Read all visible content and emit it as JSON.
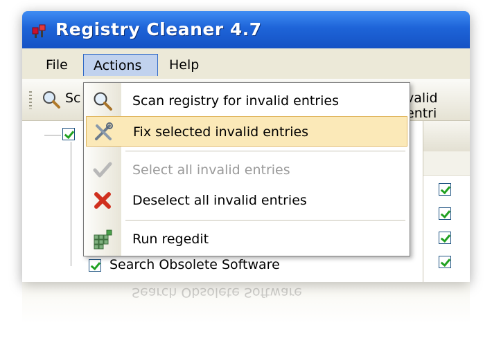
{
  "window": {
    "title": "Registry Cleaner 4.7"
  },
  "menubar": {
    "items": [
      "File",
      "Actions",
      "Help"
    ]
  },
  "toolbar": {
    "left_text": "Sc",
    "right_text": "valid entri"
  },
  "tree": {
    "visible_item": "Search Obsolete Software"
  },
  "actions_menu": {
    "items": [
      {
        "label": "Scan registry for invalid entries",
        "icon": "magnifier-icon",
        "state": "normal"
      },
      {
        "label": "Fix selected invalid entries",
        "icon": "repair-tools-icon",
        "state": "highlighted"
      },
      {
        "label": "Select all invalid entries",
        "icon": "checkmark-icon",
        "state": "disabled"
      },
      {
        "label": "Deselect all invalid entries",
        "icon": "red-x-icon",
        "state": "normal"
      },
      {
        "label": "Run regedit",
        "icon": "regedit-grid-icon",
        "state": "normal"
      }
    ]
  },
  "colors": {
    "titlebar": "#1e64d8",
    "menu_highlight": "#fbe9b8",
    "check_green": "#21a121",
    "deselect_red": "#d0301e"
  }
}
